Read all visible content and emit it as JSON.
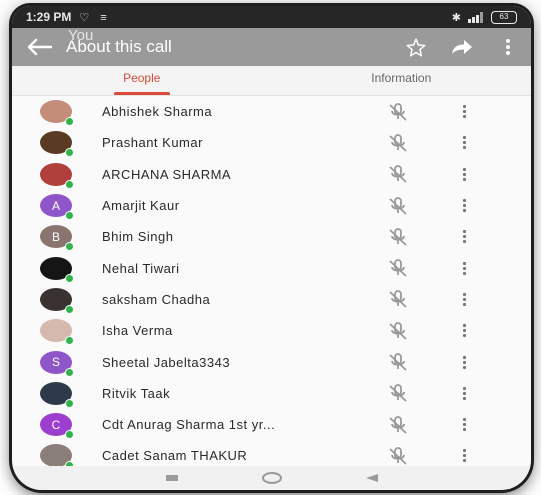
{
  "status_bar": {
    "time": "1:29 PM",
    "battery": "63"
  },
  "app_bar": {
    "title": "About this call",
    "overlay_text": "You"
  },
  "tabs": [
    {
      "label": "People",
      "active": true
    },
    {
      "label": "Information",
      "active": false
    }
  ],
  "accent_color": "#d94a3b",
  "online_color": "#2fb34a",
  "participants": [
    {
      "name": "Abhishek Sharma",
      "avatar": "photo",
      "color": "#c48d7a"
    },
    {
      "name": "Prashant Kumar",
      "avatar": "photo",
      "color": "#5b3a24"
    },
    {
      "name": "ARCHANA SHARMA",
      "avatar": "photo",
      "color": "#b0403c"
    },
    {
      "name": "Amarjit Kaur",
      "avatar": "A",
      "color": "#8e56c8"
    },
    {
      "name": "Bhim Singh",
      "avatar": "B",
      "color": "#8a7470"
    },
    {
      "name": "Nehal Tiwari",
      "avatar": "photo",
      "color": "#151515"
    },
    {
      "name": "saksham Chadha",
      "avatar": "photo",
      "color": "#3a3230"
    },
    {
      "name": "Isha Verma",
      "avatar": "photo",
      "color": "#d6b9ae"
    },
    {
      "name": "Sheetal Jabelta3343",
      "avatar": "S",
      "color": "#8e56c8"
    },
    {
      "name": "Ritvik Taak",
      "avatar": "photo",
      "color": "#2e3a4a"
    },
    {
      "name": "Cdt Anurag Sharma 1st yr...",
      "avatar": "C",
      "color": "#9c3fd0"
    },
    {
      "name": "Cadet Sanam THAKUR",
      "avatar": "photo",
      "color": "#8a7f78"
    }
  ],
  "icons": {
    "back": "arrow-back-icon",
    "star": "star-outline-icon",
    "share": "share-icon",
    "menu": "more-vert-icon",
    "muted": "mic-off-icon"
  }
}
